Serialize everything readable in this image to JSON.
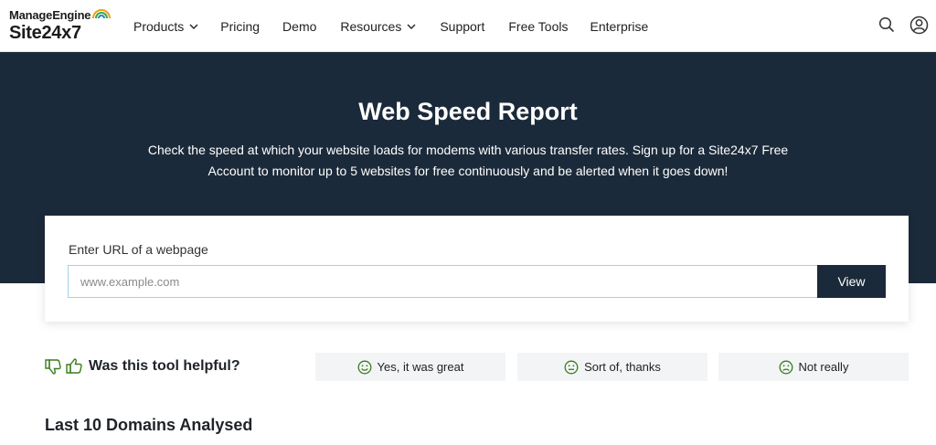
{
  "header": {
    "logo_top": "ManageEngine",
    "logo_bottom": "Site24x7",
    "nav": [
      {
        "label": "Products",
        "has_dropdown": true
      },
      {
        "label": "Pricing",
        "has_dropdown": false
      },
      {
        "label": "Demo",
        "has_dropdown": false
      },
      {
        "label": "Resources",
        "has_dropdown": true
      },
      {
        "label": "Support",
        "has_dropdown": false
      },
      {
        "label": "Free Tools",
        "has_dropdown": false
      },
      {
        "label": "Enterprise",
        "has_dropdown": false
      }
    ],
    "icons": [
      "search-icon",
      "user-icon"
    ]
  },
  "hero": {
    "title": "Web Speed Report",
    "description": "Check the speed at which your website loads for modems with various transfer rates. Sign up for a Site24x7 Free Account to monitor up to 5 websites for free continuously and be alerted when it goes down!"
  },
  "url_form": {
    "label": "Enter URL of a webpage",
    "placeholder": "www.example.com",
    "value": "",
    "button_label": "View"
  },
  "feedback": {
    "question": "Was this tool helpful?",
    "options": [
      {
        "label": "Yes, it was great",
        "icon": "smile-icon"
      },
      {
        "label": "Sort of, thanks",
        "icon": "neutral-face-icon"
      },
      {
        "label": "Not really",
        "icon": "sad-face-icon"
      }
    ]
  },
  "last_domains": {
    "title": "Last 10 Domains Analysed"
  },
  "colors": {
    "hero_bg": "#1b2a3a",
    "button_bg": "#1b2a3a",
    "feedback_icon": "#3a7d1e",
    "feedback_btn_bg": "#f3f4f6",
    "input_border": "#9fd3e6"
  }
}
